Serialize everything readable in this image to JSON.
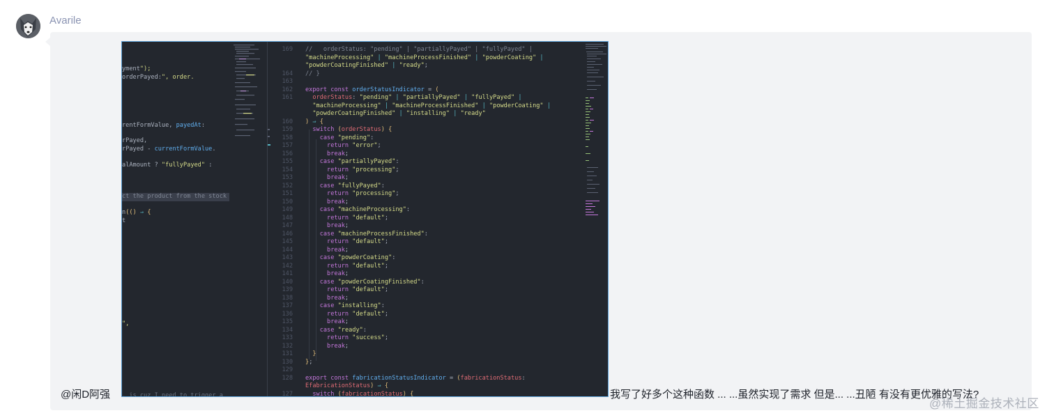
{
  "author": {
    "name": "Avarile",
    "avatar_icon": "husky-avatar-icon"
  },
  "message": {
    "mention": "@闲D阿强",
    "text": "我写了好多个这种函数 ... ...虽然实现了需求 但是... ...丑陋 有没有更优雅的写法?"
  },
  "watermark": "@稀土掘金技术社区",
  "screenshot": {
    "left_pane": [
      "yment\");",
      "orderPayed:\", order.",
      "rentFormValue, payedAt:",
      "rPayed,",
      "rPayed - currentFormValue.",
      "alAmount ? \"fullyPayed\" :",
      "ct the product from the stock",
      "n(() ⇒ {",
      "t",
      "\",",
      ". is cuz I need to trigger a"
    ],
    "right_pane": {
      "line_numbers": [
        "169",
        "",
        "",
        "164",
        "163",
        "162",
        "161",
        "",
        "",
        "160",
        "159",
        "158",
        "157",
        "156",
        "155",
        "154",
        "153",
        "152",
        "151",
        "150",
        "149",
        "148",
        "147",
        "146",
        "145",
        "144",
        "143",
        "142",
        "141",
        "140",
        "139",
        "138",
        "137",
        "136",
        "135",
        "134",
        "133",
        "132",
        "131",
        "130",
        "129",
        "128",
        "",
        "127"
      ],
      "code": [
        "//   orderStatus: \"pending\" | \"partiallyPayed\" | \"fullyPayed\" |",
        "\"machineProcessing\" | \"machineProcessFinished\" | \"powderCoating\" |",
        "\"powderCoatingFinished\" | \"ready\";",
        "// }",
        "",
        "export const orderStatusIndicator = (",
        "  orderStatus: \"pending\" | \"partiallyPayed\" | \"fullyPayed\" |",
        "  \"machineProcessing\" | \"machineProcessFinished\" | \"powderCoating\" |",
        "  \"powderCoatingFinished\" | \"installing\" | \"ready\"",
        ") ⇒ {",
        "  switch (orderStatus) {",
        "    case \"pending\":",
        "      return \"error\";",
        "      break;",
        "    case \"partiallyPayed\":",
        "      return \"processing\";",
        "      break;",
        "    case \"fullyPayed\":",
        "      return \"processing\";",
        "      break;",
        "    case \"machineProcessing\":",
        "      return \"default\";",
        "      break;",
        "    case \"machineProcessFinished\":",
        "      return \"default\";",
        "      break;",
        "    case \"powderCoating\":",
        "      return \"default\";",
        "      break;",
        "    case \"powderCoatingFinished\":",
        "      return \"default\";",
        "      break;",
        "    case \"installing\":",
        "      return \"default\";",
        "      break;",
        "    case \"ready\":",
        "      return \"success\";",
        "      break;",
        "  }",
        "};",
        "",
        "export const fabricationStatusIndicator = (fabricationStatus:",
        "EfabricationStatus) ⇒ {",
        "  switch (fabricationStatus) {"
      ]
    }
  },
  "colors": {
    "bubble_bg": "#f2f3f5",
    "editor_bg": "#23272e",
    "username": "#8a93b2",
    "screenshot_border": "#5aa0d8"
  }
}
